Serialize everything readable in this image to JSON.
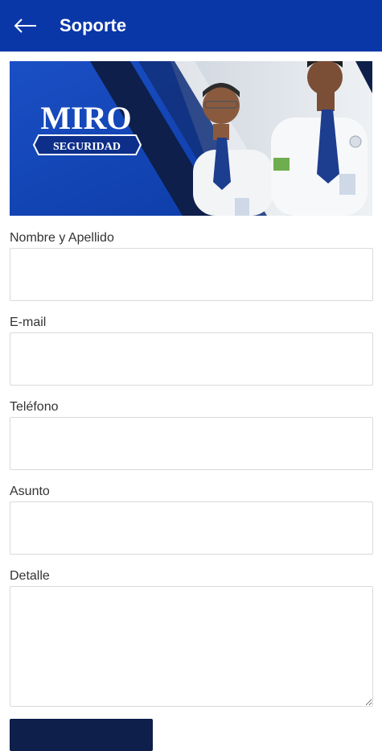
{
  "appbar": {
    "title": "Soporte",
    "back_icon": "arrow-left-icon",
    "color": "#0a37a8"
  },
  "banner": {
    "brand_name": "MIRO",
    "brand_tagline": "SEGURIDAD",
    "primary_color": "#0f44b5",
    "dark_color": "#0d1f4a"
  },
  "form": {
    "fields": [
      {
        "label": "Nombre y Apellido",
        "value": ""
      },
      {
        "label": "E-mail",
        "value": ""
      },
      {
        "label": "Teléfono",
        "value": ""
      },
      {
        "label": "Asunto",
        "value": ""
      },
      {
        "label": "Detalle",
        "value": ""
      }
    ]
  }
}
